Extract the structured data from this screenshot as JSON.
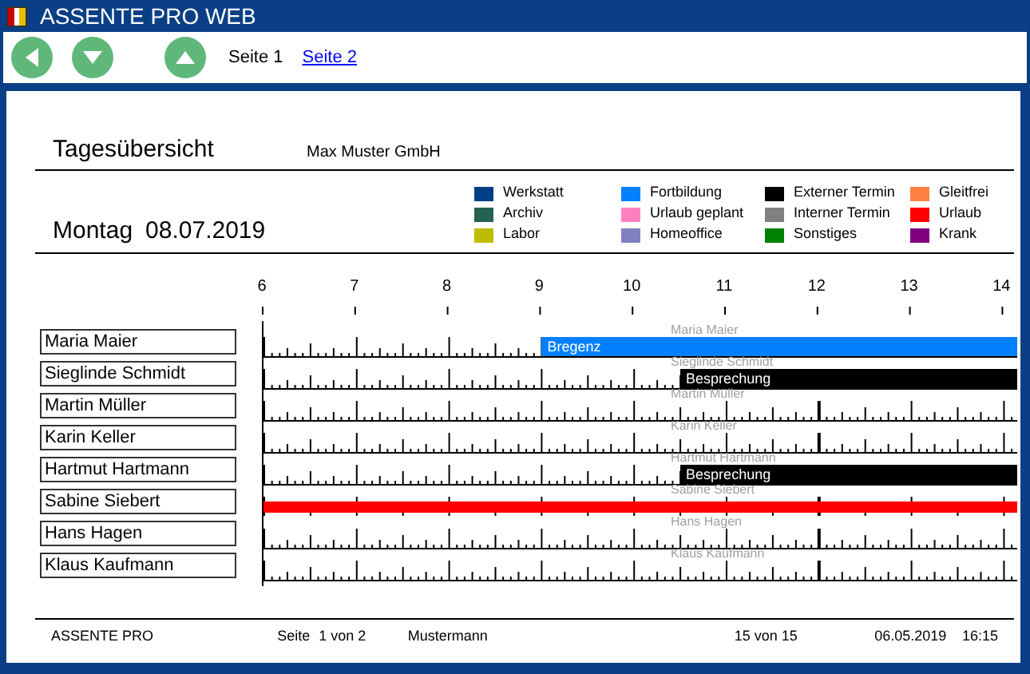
{
  "window": {
    "title": "ASSENTE PRO WEB"
  },
  "toolbar": {
    "pages": [
      {
        "label": "Seite 1",
        "selected": true
      },
      {
        "label": "Seite 2",
        "selected": false
      }
    ]
  },
  "report": {
    "title": "Tagesübersicht",
    "company": "Max Muster GmbH",
    "date_label": "Montag",
    "date": "08.07.2019"
  },
  "legend": [
    {
      "label": "Werkstatt",
      "color": "#003f87"
    },
    {
      "label": "Archiv",
      "color": "#246252"
    },
    {
      "label": "Labor",
      "color": "#bdbd00"
    },
    {
      "label": "Fortbildung",
      "color": "#0080ff"
    },
    {
      "label": "Urlaub geplant",
      "color": "#ff80c0"
    },
    {
      "label": "Homeoffice",
      "color": "#8080c0"
    },
    {
      "label": "Externer Termin",
      "color": "#000000"
    },
    {
      "label": "Interner Termin",
      "color": "#808080"
    },
    {
      "label": "Sonstiges",
      "color": "#008000"
    },
    {
      "label": "Gleitfrei",
      "color": "#ff8040"
    },
    {
      "label": "Urlaub",
      "color": "#ff0000"
    },
    {
      "label": "Krank",
      "color": "#800080"
    }
  ],
  "hours": [
    "6",
    "7",
    "8",
    "9",
    "10",
    "11",
    "12",
    "13",
    "14"
  ],
  "rows": [
    {
      "name": "Maria Maier",
      "ghost": "Maria Maier",
      "bar": {
        "label": "Bregenz",
        "level": 0.632,
        "color": "#0080ff"
      }
    },
    {
      "name": "Sieglinde Schmidt",
      "ghost": "Sieglinde Schmidt",
      "bar": {
        "label": "Besprechung",
        "level": 0.448,
        "color": "#000000"
      }
    },
    {
      "name": "Martin Müller",
      "ghost": "Martin Müller"
    },
    {
      "name": "Karin Keller",
      "ghost": "Karin Keller"
    },
    {
      "name": "Hartmut Hartmann",
      "ghost": "Hartmut Hartmann",
      "bar": {
        "label": "Besprechung",
        "level": 0.448,
        "color": "#000000"
      }
    },
    {
      "name": "Sabine Siebert",
      "ghost": "Sabine Siebert",
      "bar": {
        "level": 1,
        "color": "#ff0000"
      }
    },
    {
      "name": "Hans Hagen",
      "ghost": "Hans Hagen"
    },
    {
      "name": "Klaus Kaufmann",
      "ghost": "Klaus Kaufmann"
    }
  ],
  "footer": {
    "app": "ASSENTE PRO",
    "page_label": "Seite",
    "page": "1 von 2",
    "user": "Mustermann",
    "count": "15 von 15",
    "date": "06.05.2019",
    "time": "16:15"
  }
}
